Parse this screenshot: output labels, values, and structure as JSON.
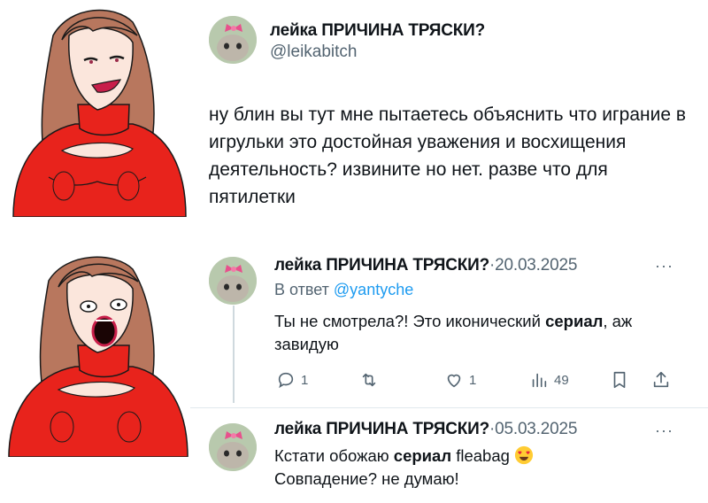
{
  "tweet_main": {
    "display_name": "лейка ПРИЧИНА ТРЯСКИ?",
    "handle": "@leikabitch",
    "text": "ну блин вы тут мне пытаетесь объяснить что играние в игрульки это достойная уважения и восхищения деятельность? извините но нет. разве что для пятилетки"
  },
  "reply_1": {
    "display_name": "лейка ПРИЧИНА ТРЯСКИ?",
    "separator": "·",
    "date": "20.03.2025",
    "more": "···",
    "reply_to_prefix": "В ответ",
    "reply_to_handle": "@yantyche",
    "text_before": "Ты не смотрела?! Это иконический ",
    "text_bold": "сериал",
    "text_after": ", аж завидую",
    "stats": {
      "replies": "1",
      "retweets": "",
      "likes": "1",
      "views": "49"
    }
  },
  "reply_2": {
    "display_name": "лейка ПРИЧИНА ТРЯСКИ?",
    "separator": "·",
    "date": "05.03.2025",
    "more": "···",
    "line1_before": "Кстати обожаю ",
    "line1_bold": "сериал",
    "line1_after": " fleabag",
    "line2": "Совпадение? не думаю!"
  },
  "icons": {
    "reply": "reply-icon",
    "retweet": "retweet-icon",
    "like": "heart-icon",
    "views": "views-icon",
    "bookmark": "bookmark-icon",
    "share": "share-icon",
    "emoji": "heart-eyes-emoji-icon"
  },
  "colors": {
    "sweater": "#e8231c",
    "hair": "#b8775e",
    "skin": "#fbe6dc",
    "link": "#1d9bf0",
    "secondary_text": "#536471",
    "avatar_bow": "#e8508c"
  }
}
